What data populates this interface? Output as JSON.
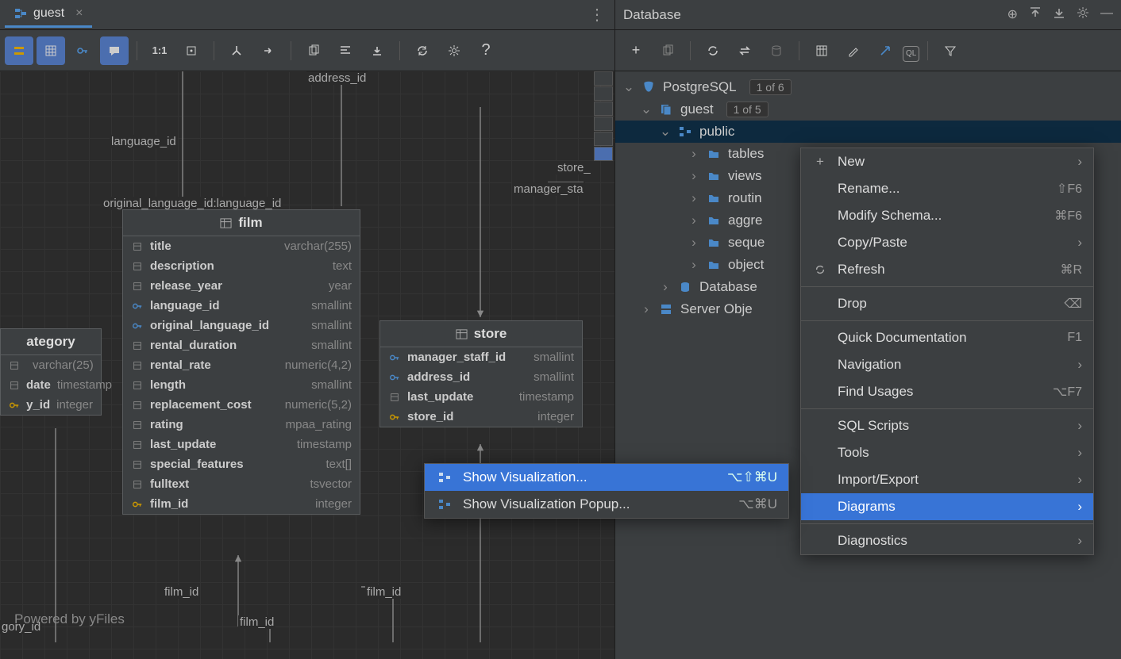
{
  "tab": {
    "label": "guest"
  },
  "canvas": {
    "labels": {
      "language_id": "language_id",
      "original_language_id": "original_language_id:language_id",
      "address_id": "address_id",
      "store_": "store_",
      "manager_sta": "manager_sta",
      "film_id_1": "film_id",
      "film_id_2": "film_id",
      "film_id_3": "film_id",
      "gory_id": "gory_id"
    },
    "powered": "Powered by yFiles"
  },
  "film": {
    "title": "film",
    "cols": [
      {
        "name": "title",
        "type": "varchar(255)",
        "k": "col"
      },
      {
        "name": "description",
        "type": "text",
        "k": "col"
      },
      {
        "name": "release_year",
        "type": "year",
        "k": "col"
      },
      {
        "name": "language_id",
        "type": "smallint",
        "k": "fk"
      },
      {
        "name": "original_language_id",
        "type": "smallint",
        "k": "fk"
      },
      {
        "name": "rental_duration",
        "type": "smallint",
        "k": "col"
      },
      {
        "name": "rental_rate",
        "type": "numeric(4,2)",
        "k": "col"
      },
      {
        "name": "length",
        "type": "smallint",
        "k": "col"
      },
      {
        "name": "replacement_cost",
        "type": "numeric(5,2)",
        "k": "col"
      },
      {
        "name": "rating",
        "type": "mpaa_rating",
        "k": "col"
      },
      {
        "name": "last_update",
        "type": "timestamp",
        "k": "col"
      },
      {
        "name": "special_features",
        "type": "text[]",
        "k": "col"
      },
      {
        "name": "fulltext",
        "type": "tsvector",
        "k": "col"
      },
      {
        "name": "film_id",
        "type": "integer",
        "k": "pk"
      }
    ]
  },
  "store": {
    "title": "store",
    "cols": [
      {
        "name": "manager_staff_id",
        "type": "smallint",
        "k": "fk"
      },
      {
        "name": "address_id",
        "type": "smallint",
        "k": "fk"
      },
      {
        "name": "last_update",
        "type": "timestamp",
        "k": "col"
      },
      {
        "name": "store_id",
        "type": "integer",
        "k": "pk"
      }
    ]
  },
  "category_partial": {
    "title": "ategory",
    "cols": [
      {
        "name": "",
        "type": "varchar(25)",
        "k": "col"
      },
      {
        "name": "date",
        "type": "timestamp",
        "k": "col"
      },
      {
        "name": "y_id",
        "type": "integer",
        "k": "pk"
      }
    ]
  },
  "db": {
    "title": "Database",
    "root": {
      "label": "PostgreSQL",
      "badge": "1 of 6"
    },
    "guest": {
      "label": "guest",
      "badge": "1 of 5"
    },
    "public": {
      "label": "public"
    },
    "folders": [
      "tables",
      "views",
      "routin",
      "aggre",
      "seque",
      "object"
    ],
    "dbobj": "Database",
    "server": "Server Obje"
  },
  "ctx": {
    "new": "New",
    "rename": "Rename...",
    "rename_sc": "⇧F6",
    "modify": "Modify Schema...",
    "modify_sc": "⌘F6",
    "copy": "Copy/Paste",
    "refresh": "Refresh",
    "refresh_sc": "⌘R",
    "drop": "Drop",
    "quickdoc": "Quick Documentation",
    "quickdoc_sc": "F1",
    "nav": "Navigation",
    "find": "Find Usages",
    "find_sc": "⌥F7",
    "sql": "SQL Scripts",
    "tools": "Tools",
    "impexp": "Import/Export",
    "diagrams": "Diagrams",
    "diag": "Diagnostics"
  },
  "sub": {
    "show": "Show Visualization...",
    "show_sc": "⌥⇧⌘U",
    "popup": "Show Visualization Popup...",
    "popup_sc": "⌥⌘U"
  }
}
